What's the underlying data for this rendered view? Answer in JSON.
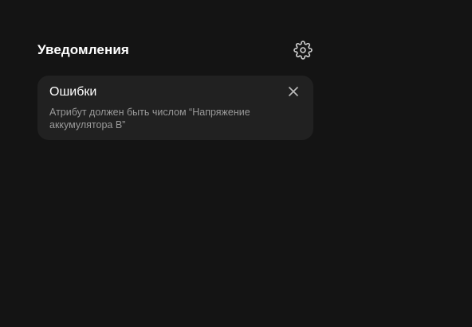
{
  "notifications": {
    "title": "Уведомления",
    "settings_icon": "gear-icon",
    "items": [
      {
        "title": "Ошибки",
        "message": "Атрибут должен быть числом “Напряжение аккумулятора В”",
        "close_icon": "close-icon"
      }
    ]
  },
  "colors": {
    "background": "#141414",
    "card": "#212121",
    "text_primary": "#ffffff",
    "text_secondary": "#9a9a9a"
  }
}
